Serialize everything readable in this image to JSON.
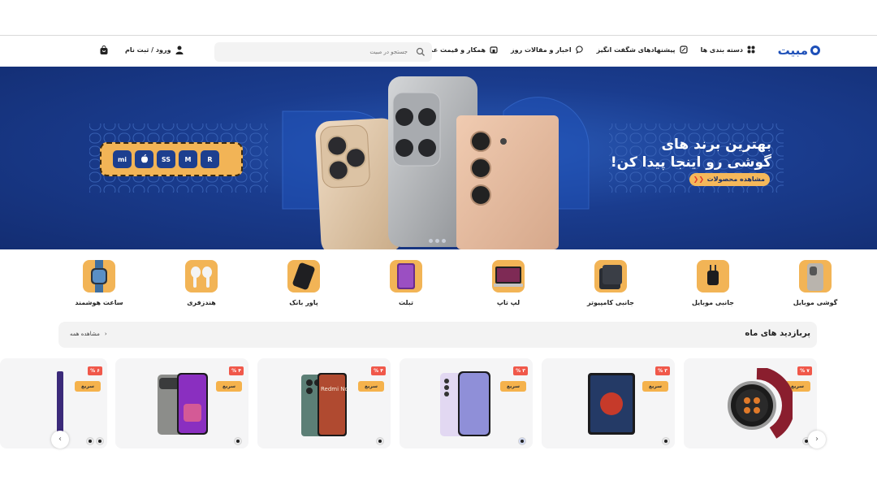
{
  "header": {
    "logo": "مبیت",
    "nav": [
      {
        "label": "دسته بندی ها",
        "icon": "grid-icon"
      },
      {
        "label": "پیشنهادهای شگفت انگیز",
        "icon": "percent-tag-icon"
      },
      {
        "label": "اخبار و مقالات روز",
        "icon": "chat-bubble-icon"
      },
      {
        "label": "همکار و قیمت عمده",
        "icon": "store-icon"
      }
    ],
    "search_placeholder": "جستجو در مبیت",
    "login_label": "ورود / ثبت نام"
  },
  "banner": {
    "title_line1": "بهترین برند های",
    "title_line2": "گوشی رو اینجا پیدا کن!",
    "button_label": "مشاهده محصولات",
    "brands": [
      "mi",
      "",
      "SS",
      "M",
      "R"
    ]
  },
  "categories": [
    {
      "label": "گوشی موبایل",
      "icon": "phone-icon"
    },
    {
      "label": "جانبی موبایل",
      "icon": "charger-icon"
    },
    {
      "label": "جانبی کامپیوتر",
      "icon": "case-icon"
    },
    {
      "label": "لپ تاپ",
      "icon": "laptop-icon"
    },
    {
      "label": "تبلت",
      "icon": "tablet-icon"
    },
    {
      "label": "پاور بانک",
      "icon": "powerbank-icon"
    },
    {
      "label": "هندزفری",
      "icon": "earbuds-icon"
    },
    {
      "label": "ساعت هوشمند",
      "icon": "watch-icon"
    }
  ],
  "section": {
    "title": "پربازدید های ماه",
    "see_all": "مشاهده همه"
  },
  "products": [
    {
      "discount": "۷ %",
      "badge": "سریع",
      "type": "watch"
    },
    {
      "discount": "۳ %",
      "badge": "سریع",
      "type": "tablet"
    },
    {
      "discount": "۳ %",
      "badge": "سریع",
      "type": "phone-violet"
    },
    {
      "discount": "۴ %",
      "badge": "سریع",
      "type": "phone-redmi"
    },
    {
      "discount": "۴ %",
      "badge": "سریع",
      "type": "phone-gray"
    },
    {
      "discount": "۶ %",
      "badge": "سریع",
      "type": "phone-partial"
    }
  ],
  "product_image_text": "Redmi Note 13",
  "colors": {
    "brand_blue": "#1d4fb8",
    "accent_orange": "#f2b456",
    "discount_red": "#f0584a"
  }
}
